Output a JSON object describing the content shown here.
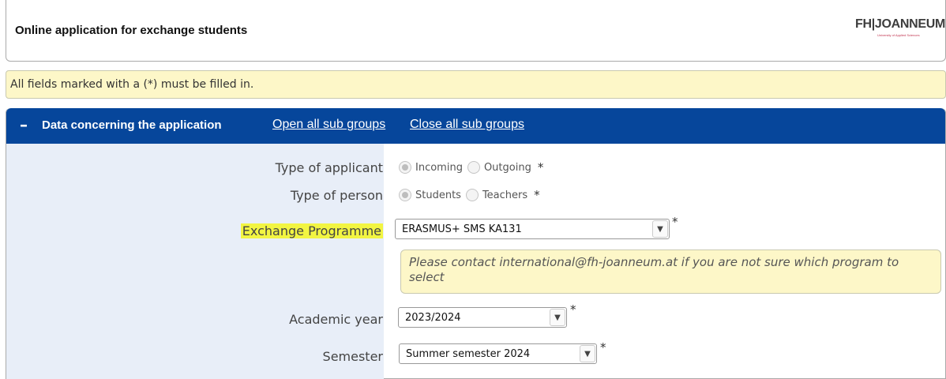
{
  "header": {
    "title": "Online application for exchange students",
    "logo_text": "FH|JOANNEUM",
    "logo_subtext": "University of Applied Sciences"
  },
  "notice": {
    "text": "All fields marked with a (*) must be filled in."
  },
  "panel": {
    "title": "Data concerning the application",
    "open_all": "Open all sub groups",
    "close_all": "Close all sub groups"
  },
  "form": {
    "type_of_applicant": {
      "label": "Type of applicant",
      "options": [
        "Incoming",
        "Outgoing"
      ],
      "required": "*"
    },
    "type_of_person": {
      "label": "Type of person",
      "options": [
        "Students",
        "Teachers"
      ],
      "required": "*"
    },
    "exchange_programme": {
      "label": "Exchange Programme",
      "value": "ERASMUS+ SMS KA131",
      "required": "*",
      "hint": "Please contact international@fh-joanneum.at if you are not sure which program to select"
    },
    "academic_year": {
      "label": "Academic year",
      "value": "2023/2024",
      "required": "*"
    },
    "semester": {
      "label": "Semester",
      "value": "Summer semester 2024",
      "required": "*"
    }
  },
  "colors": {
    "panel_header": "#06469b",
    "notice_bg": "#fdf7c8",
    "label_bg": "#e8eef8",
    "highlight": "#f2f542"
  }
}
